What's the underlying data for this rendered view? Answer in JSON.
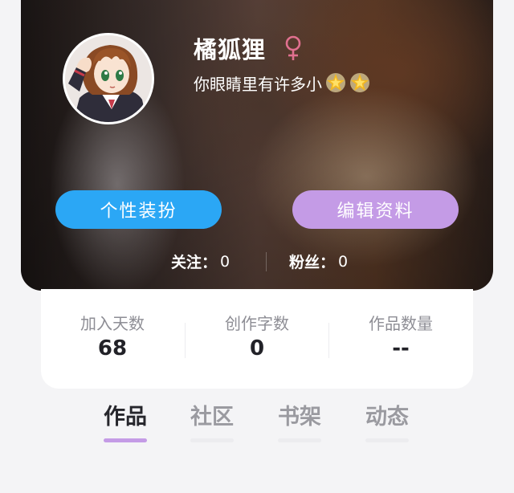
{
  "profile": {
    "username": "橘狐狸",
    "gender_icon": "female-symbol-icon",
    "signature": "你眼睛里有许多小",
    "signature_icons": [
      "glowing-star-icon",
      "glowing-star-icon"
    ]
  },
  "actions": {
    "dress_up_label": "个性装扮",
    "edit_profile_label": "编辑资料"
  },
  "follow": {
    "following_label": "关注：",
    "following_count": "0",
    "fans_label": "粉丝：",
    "fans_count": "0"
  },
  "stats": [
    {
      "label": "加入天数",
      "value": "68"
    },
    {
      "label": "创作字数",
      "value": "0"
    },
    {
      "label": "作品数量",
      "value": "--"
    }
  ],
  "tabs": [
    {
      "label": "作品",
      "active": true
    },
    {
      "label": "社区",
      "active": false
    },
    {
      "label": "书架",
      "active": false
    },
    {
      "label": "动态",
      "active": false
    }
  ],
  "colors": {
    "dress_button": "#2ba7f5",
    "edit_button": "#c49be6",
    "active_tab_indicator": "#c49be6",
    "gender_icon": "#e0708f"
  }
}
